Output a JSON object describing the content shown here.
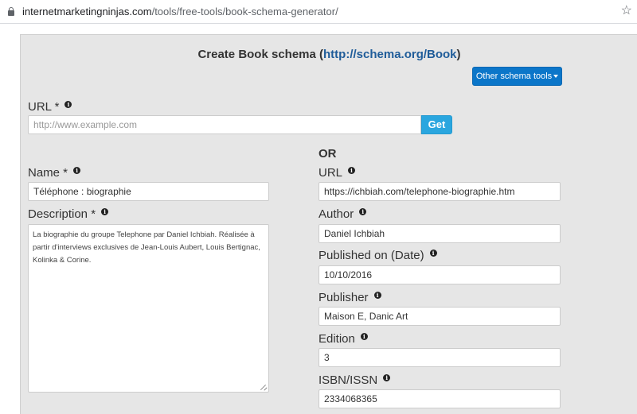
{
  "browser": {
    "url_domain": "internetmarketingninjas.com",
    "url_path": "/tools/free-tools/book-schema-generator/"
  },
  "header": {
    "title_prefix": "Create Book schema (",
    "title_link": "http://schema.org/Book",
    "title_suffix": ")",
    "other_tools_label": "Other schema tools"
  },
  "url_section": {
    "label": "URL *",
    "placeholder": "http://www.example.com",
    "get_label": "Get"
  },
  "or_label": "OR",
  "left": {
    "name_label": "Name *",
    "name_value": "Téléphone : biographie",
    "description_label": "Description *",
    "description_value": "La biographie du groupe Telephone par Daniel Ichbiah. Réalisée à partir d'interviews exclusives de Jean-Louis Aubert, Louis Bertignac, Kolinka & Corine."
  },
  "right": {
    "url_label": "URL",
    "url_value": "https://ichbiah.com/telephone-biographie.htm",
    "author_label": "Author",
    "author_value": "Daniel Ichbiah",
    "published_label": "Published on (Date)",
    "published_value": "10/10/2016",
    "publisher_label": "Publisher",
    "publisher_value": "Maison E, Danic Art",
    "edition_label": "Edition",
    "edition_value": "3",
    "isbn_label": "ISBN/ISSN",
    "isbn_value": "2334068365"
  },
  "icons": {
    "info": "info-circle-icon",
    "lock": "lock-icon",
    "star": "bookmark-star-icon"
  },
  "colors": {
    "panel_bg": "#e6e6e6",
    "primary_button": "#0b76c9",
    "get_button": "#2aa6df",
    "link": "#1f5c99"
  }
}
